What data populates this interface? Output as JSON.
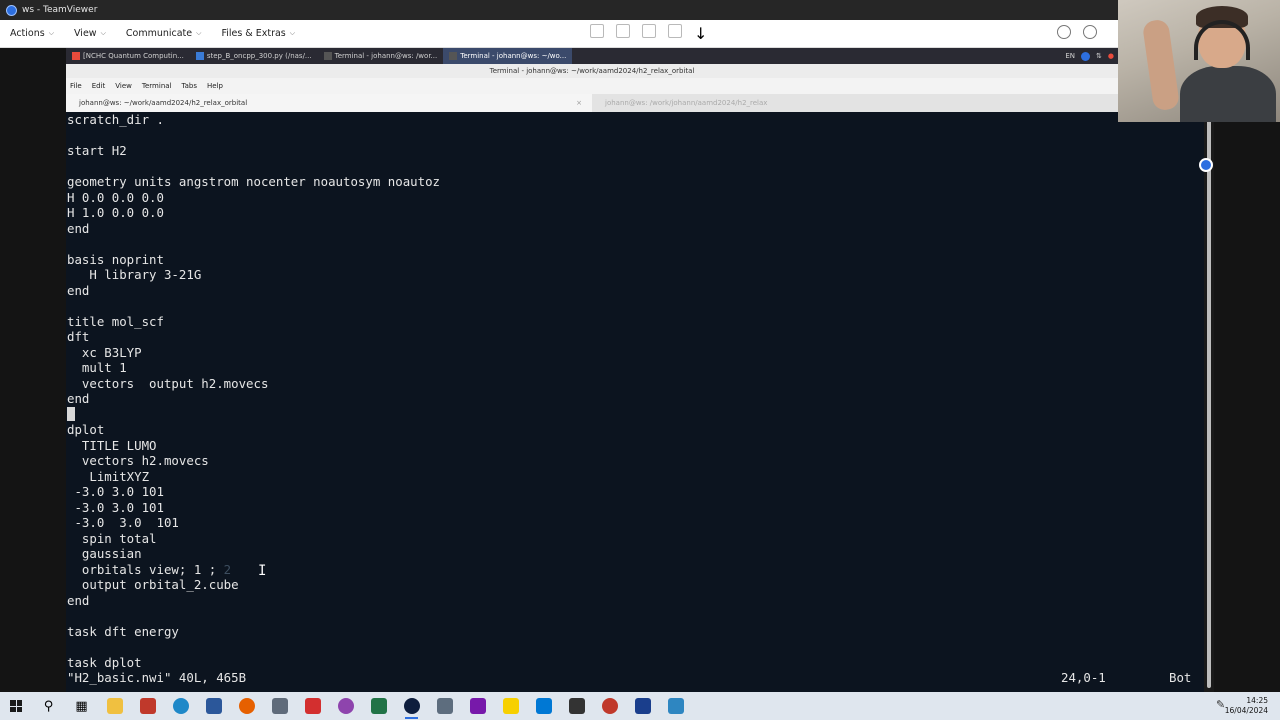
{
  "teamviewer": {
    "title": "ws - TeamViewer",
    "menu": [
      {
        "label": "Actions"
      },
      {
        "label": "View"
      },
      {
        "label": "Communicate"
      },
      {
        "label": "Files & Extras"
      }
    ]
  },
  "remote_taskbar": {
    "items": [
      {
        "label": "[NCHC Quantum Computin...",
        "color": "#e94b3c"
      },
      {
        "label": "step_B_oncpp_300.py (/nas/...",
        "color": "#3a7bd5"
      },
      {
        "label": "Terminal - johann@ws: /wor...",
        "color": "#444444"
      },
      {
        "label": "Terminal - johann@ws: ~/wo...",
        "color": "#444444"
      }
    ],
    "tray_lang": "EN"
  },
  "terminal": {
    "window_title": "Terminal - johann@ws: ~/work/aamd2024/h2_relax_orbital",
    "menu": [
      "File",
      "Edit",
      "View",
      "Terminal",
      "Tabs",
      "Help"
    ],
    "tabs": [
      {
        "label": "johann@ws: ~/work/aamd2024/h2_relax_orbital"
      },
      {
        "label": "johann@ws: /work/johann/aamd2024/h2_relax"
      }
    ],
    "lines": [
      "scratch_dir .",
      "",
      "start H2",
      "",
      "geometry units angstrom nocenter noautosym noautoz",
      "H 0.0 0.0 0.0",
      "H 1.0 0.0 0.0",
      "end",
      "",
      "basis noprint",
      "   H library 3-21G",
      "end",
      "",
      "title mol_scf",
      "dft",
      "  xc B3LYP",
      "  mult 1",
      "  vectors  output h2.movecs",
      "end",
      "",
      "dplot",
      "  TITLE LUMO",
      "  vectors h2.movecs",
      "   LimitXYZ",
      " -3.0 3.0 101",
      " -3.0 3.0 101",
      " -3.0  3.0  101",
      "  spin total",
      "  gaussian",
      "  orbitals view; 1 ;",
      "  output orbital_2.cube",
      "end",
      "",
      "task dft energy",
      "",
      "task dplot"
    ],
    "faded_suffix": " 2",
    "status_file": "\"H2_basic.nwi\" 40L, 465B",
    "status_pos": "24,0-1",
    "status_scroll": "Bot"
  },
  "clock": {
    "time": "14:25",
    "date": "16/04/2024"
  }
}
